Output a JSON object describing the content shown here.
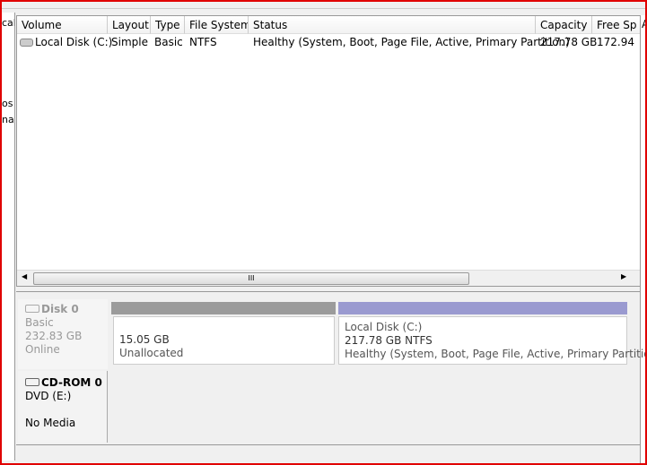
{
  "left_strip": [
    "cal",
    "os",
    "na"
  ],
  "columns": [
    "Volume",
    "Layout",
    "Type",
    "File System",
    "Status",
    "Capacity",
    "Free Sp"
  ],
  "right_col_header": "A",
  "rows": [
    {
      "volume": "Local Disk (C:)",
      "layout": "Simple",
      "type": "Basic",
      "fs": "NTFS",
      "status": "Healthy (System, Boot, Page File, Active, Primary Partition)",
      "capacity": "217.78 GB",
      "free": "172.94 "
    }
  ],
  "scroll_grip": "III",
  "disks": [
    {
      "name": "Disk 0",
      "type": "Basic",
      "size": "232.83 GB",
      "state": "Online"
    },
    {
      "name": "CD-ROM 0",
      "type": "DVD (E:)",
      "state": "No Media"
    }
  ],
  "partitions": [
    {
      "size": "15.05 GB",
      "label": "Unallocated",
      "bar_color": "#9b9b9b"
    },
    {
      "name": "Local Disk  (C:)",
      "size": "217.78 GB NTFS",
      "status": "Healthy (System, Boot, Page File, Active, Primary Partition)",
      "bar_color": "#9a9ad0"
    }
  ]
}
